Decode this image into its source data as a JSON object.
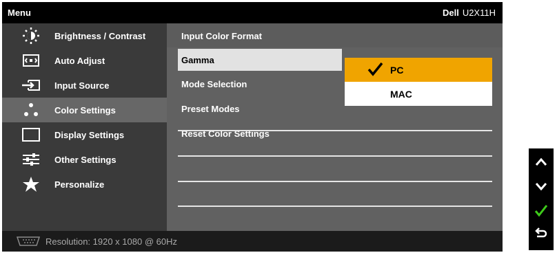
{
  "header": {
    "menu_title": "Menu",
    "brand": "Dell",
    "model": "U2X11H"
  },
  "sidebar": {
    "items": [
      {
        "label": "Brightness / Contrast",
        "icon": "brightness-icon"
      },
      {
        "label": "Auto Adjust",
        "icon": "auto-adjust-icon"
      },
      {
        "label": "Input Source",
        "icon": "input-source-icon"
      },
      {
        "label": "Color Settings",
        "icon": "color-settings-icon",
        "selected": true
      },
      {
        "label": "Display Settings",
        "icon": "display-settings-icon"
      },
      {
        "label": "Other Settings",
        "icon": "other-settings-icon"
      },
      {
        "label": "Personalize",
        "icon": "star-icon"
      }
    ]
  },
  "color_settings": {
    "rows": [
      {
        "label": "Input Color Format"
      },
      {
        "label": "Gamma",
        "active": true
      },
      {
        "label": "Mode Selection"
      },
      {
        "label": "Preset Modes"
      },
      {
        "label": "Reset Color Settings"
      }
    ],
    "gamma_options": [
      {
        "label": "PC",
        "selected": true
      },
      {
        "label": "MAC",
        "selected": false
      }
    ]
  },
  "footer": {
    "resolution": "Resolution: 1920 x 1080 @ 60Hz",
    "icon": "vga-icon"
  },
  "nav_buttons": [
    {
      "name": "up-arrow-icon"
    },
    {
      "name": "down-arrow-icon"
    },
    {
      "name": "check-icon"
    },
    {
      "name": "back-icon"
    }
  ],
  "colors": {
    "selected_option": "#f0a400",
    "sidebar_bg": "#3a3a3a",
    "content_bg": "#616161",
    "check_green": "#3ecb1a"
  }
}
